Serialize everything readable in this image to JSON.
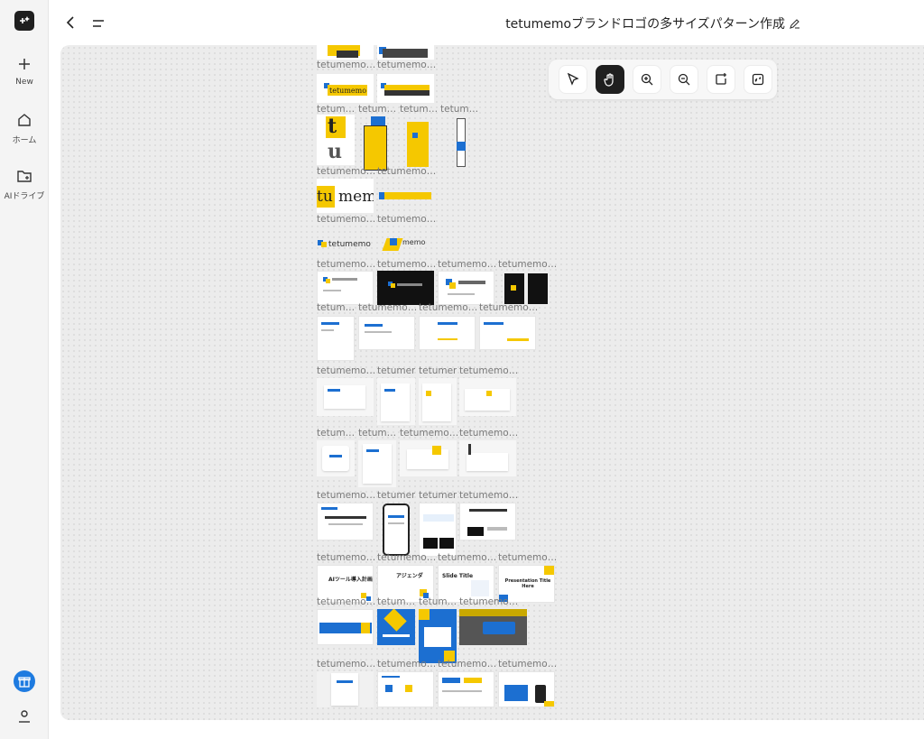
{
  "sidebar": {
    "items": [
      {
        "label": "New"
      },
      {
        "label": "ホーム"
      },
      {
        "label": "AIドライブ"
      }
    ]
  },
  "header": {
    "title": "tetumemoブランドロゴの多サイズパターン作成"
  },
  "toolbar": {
    "tools": [
      "select-tool",
      "hand-tool",
      "zoom-in",
      "zoom-out",
      "add-frame",
      "fit-view"
    ],
    "active": "hand-tool"
  },
  "canvas": {
    "label_truncated": "tetumemo…",
    "label_short": "tetum…",
    "thumb_text": {
      "t": "t",
      "u": "u",
      "tet": "tet",
      "memo": "memo",
      "tu": "tu",
      "mem": "mem",
      "tetumemo": "tetumemo",
      "ai_plan": "AIツール導入計画",
      "agenda": "アジェンダ",
      "slide_title": "Slide Title",
      "pres_title": "Presentation Title Here"
    }
  },
  "colors": {
    "accent_yellow": "#f5c800",
    "accent_blue": "#1c6fd1",
    "dark": "#1f1f1f"
  }
}
